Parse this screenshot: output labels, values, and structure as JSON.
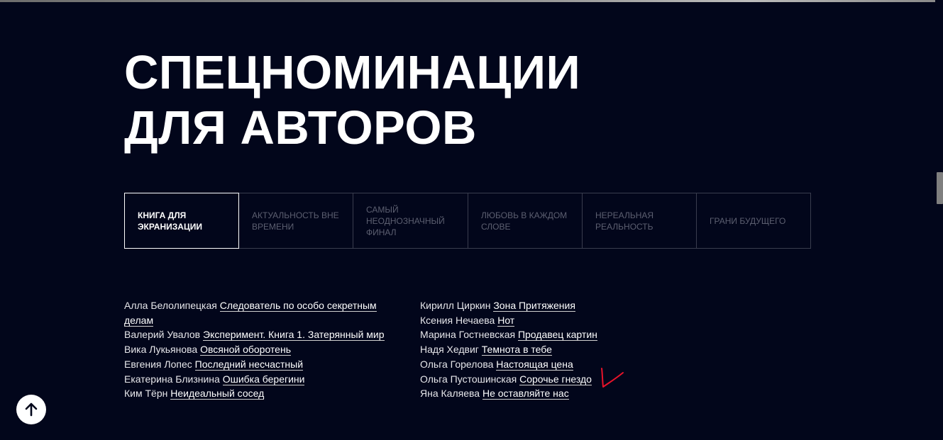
{
  "title": {
    "line1": "СПЕЦНОМИНАЦИИ",
    "line2": "ДЛЯ АВТОРОВ"
  },
  "tabs": [
    {
      "label": "КНИГА ДЛЯ ЭКРАНИЗАЦИИ",
      "active": true
    },
    {
      "label": "АКТУАЛЬНОСТЬ ВНЕ ВРЕМЕНИ",
      "active": false
    },
    {
      "label": "САМЫЙ НЕОДНОЗНАЧНЫЙ ФИНАЛ",
      "active": false
    },
    {
      "label": "ЛЮБОВЬ В КАЖДОМ СЛОВЕ",
      "active": false
    },
    {
      "label": "НЕРЕАЛЬНАЯ РЕАЛЬНОСТЬ",
      "active": false
    },
    {
      "label": "ГРАНИ БУДУЩЕГО",
      "active": false
    }
  ],
  "nominees_left": [
    {
      "author": "Алла Белолипецкая",
      "book": "Следователь по особо секретным делам"
    },
    {
      "author": "Валерий Увалов",
      "book": "Эксперимент. Книга 1. Затерянный мир"
    },
    {
      "author": "Вика Лукьянова",
      "book": "Овсяной оборотень"
    },
    {
      "author": "Евгения Лопес",
      "book": "Последний несчастный"
    },
    {
      "author": "Екатерина Близнина",
      "book": "Ошибка берегини"
    },
    {
      "author": "Ким Тёрн",
      "book": "Неидеальный сосед"
    }
  ],
  "nominees_right": [
    {
      "author": "Кирилл Циркин",
      "book": "Зона Притяжения"
    },
    {
      "author": "Ксения Нечаева",
      "book": "Нот"
    },
    {
      "author": "Марина Гостневская",
      "book": "Продавец картин"
    },
    {
      "author": "Надя Хедвиг",
      "book": "Темнота в тебе"
    },
    {
      "author": "Ольга Горелова",
      "book": "Настоящая цена"
    },
    {
      "author": "Ольга Пустошинская",
      "book": "Сорочье гнездо"
    },
    {
      "author": "Яна Каляева",
      "book": "Не оставляйте нас"
    }
  ],
  "icons": {
    "scroll_top": "arrow-up-icon",
    "annotation": "red-checkmark"
  },
  "colors": {
    "background": "#02061b",
    "text": "#ffffff",
    "tab_inactive": "#5c5f70",
    "annotation": "#e8132a"
  }
}
